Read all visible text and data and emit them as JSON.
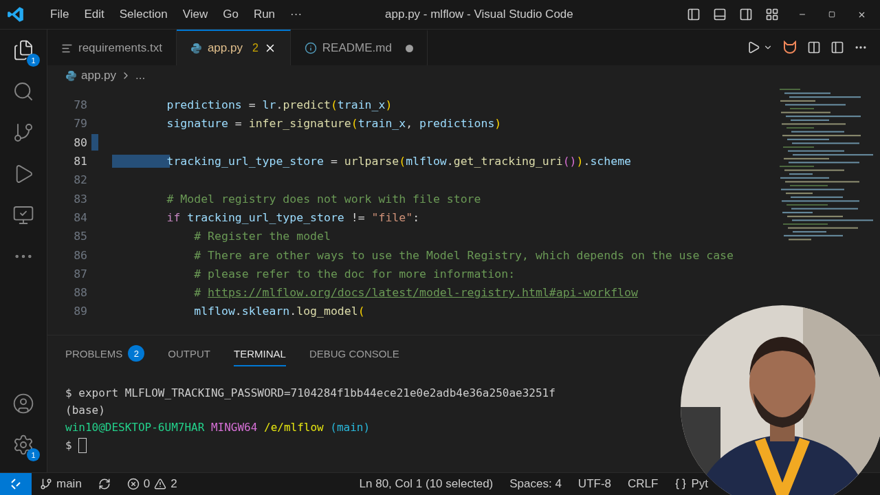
{
  "window": {
    "title": "app.py - mlflow - Visual Studio Code"
  },
  "menu": [
    "File",
    "Edit",
    "Selection",
    "View",
    "Go",
    "Run",
    "···"
  ],
  "activity_bar": {
    "explorer_badge": "1",
    "settings_badge": "1"
  },
  "tabs": [
    {
      "label": "requirements.txt",
      "kind": "text",
      "selected": false,
      "modified": false
    },
    {
      "label": "app.py",
      "kind": "python",
      "selected": true,
      "problems": "2",
      "modified": false
    },
    {
      "label": "README.md",
      "kind": "info",
      "selected": false,
      "modified": true
    }
  ],
  "breadcrumb": [
    "app.py",
    "..."
  ],
  "editor": {
    "lines": [
      {
        "number": "78",
        "selected": false,
        "tokens": [
          {
            "text": "        predictions",
            "kind": "var"
          },
          {
            "text": " = ",
            "kind": "op"
          },
          {
            "text": "lr",
            "kind": "var"
          },
          {
            "text": ".",
            "kind": "op"
          },
          {
            "text": "predict",
            "kind": "func"
          },
          {
            "text": "(",
            "kind": "paren"
          },
          {
            "text": "train_x",
            "kind": "var"
          },
          {
            "text": ")",
            "kind": "paren"
          }
        ]
      },
      {
        "number": "79",
        "selected": false,
        "tokens": [
          {
            "text": "        signature",
            "kind": "var"
          },
          {
            "text": " = ",
            "kind": "op"
          },
          {
            "text": "infer_signature",
            "kind": "func"
          },
          {
            "text": "(",
            "kind": "paren"
          },
          {
            "text": "train_x",
            "kind": "var"
          },
          {
            "text": ", ",
            "kind": "op"
          },
          {
            "text": "predictions",
            "kind": "var"
          },
          {
            "text": ")",
            "kind": "paren"
          }
        ]
      },
      {
        "number": "80",
        "selected": true
      },
      {
        "number": "81",
        "selected": true,
        "tokens": [
          {
            "text": "        tracking_url_type_store",
            "kind": "var"
          },
          {
            "text": " = ",
            "kind": "op"
          },
          {
            "text": "urlparse",
            "kind": "func"
          },
          {
            "text": "(",
            "kind": "paren"
          },
          {
            "text": "mlflow",
            "kind": "var"
          },
          {
            "text": ".",
            "kind": "op"
          },
          {
            "text": "get_tracking_uri",
            "kind": "func"
          },
          {
            "text": "()",
            "kind": "paren2"
          },
          {
            "text": ")",
            "kind": "paren"
          },
          {
            "text": ".",
            "kind": "op"
          },
          {
            "text": "scheme",
            "kind": "var"
          }
        ]
      },
      {
        "number": "82",
        "selected": false
      },
      {
        "number": "83",
        "selected": false,
        "tokens": [
          {
            "text": "        # Model registry does not work with file store",
            "kind": "comment"
          }
        ]
      },
      {
        "number": "84",
        "selected": false,
        "tokens": [
          {
            "text": "        if",
            "kind": "keyword"
          },
          {
            "text": " tracking_url_type_store",
            "kind": "var"
          },
          {
            "text": " != ",
            "kind": "op"
          },
          {
            "text": "\"file\"",
            "kind": "string"
          },
          {
            "text": ":",
            "kind": "op"
          }
        ]
      },
      {
        "number": "85",
        "selected": false,
        "tokens": [
          {
            "text": "            # Register the model",
            "kind": "comment"
          }
        ]
      },
      {
        "number": "86",
        "selected": false,
        "tokens": [
          {
            "text": "            # There are other ways to use the Model Registry, which depends on the use case",
            "kind": "comment"
          }
        ]
      },
      {
        "number": "87",
        "selected": false,
        "tokens": [
          {
            "text": "            # please refer to the doc for more information:",
            "kind": "comment"
          }
        ]
      },
      {
        "number": "88",
        "selected": false,
        "tokens": [
          {
            "text": "            # ",
            "kind": "comment"
          },
          {
            "text": "https://mlflow.org/docs/latest/model-registry.html#api-workflow",
            "kind": "link"
          }
        ]
      },
      {
        "number": "89",
        "selected": false,
        "tokens": [
          {
            "text": "            mlflow",
            "kind": "var"
          },
          {
            "text": ".",
            "kind": "op"
          },
          {
            "text": "sklearn",
            "kind": "var"
          },
          {
            "text": ".",
            "kind": "op"
          },
          {
            "text": "log_model",
            "kind": "func"
          },
          {
            "text": "(",
            "kind": "paren"
          }
        ]
      }
    ]
  },
  "panel": {
    "tabs": [
      {
        "label": "PROBLEMS",
        "badge": "2",
        "selected": false
      },
      {
        "label": "OUTPUT",
        "selected": false
      },
      {
        "label": "TERMINAL",
        "selected": true
      },
      {
        "label": "DEBUG CONSOLE",
        "selected": false
      }
    ],
    "terminal": [
      [
        {
          "text": "$ export MLFLOW_TRACKING_PASSWORD=7104284f1bb44ece21e0e2adb4e36a250ae3251f",
          "kind": "plain"
        }
      ],
      [
        {
          "text": "(base)",
          "kind": "plain"
        }
      ],
      [
        {
          "text": "win10@DESKTOP-6UM7HAR",
          "kind": "user"
        },
        {
          "text": " MINGW64",
          "kind": "host"
        },
        {
          "text": " /e/mlflow",
          "kind": "path"
        },
        {
          "text": " (main)",
          "kind": "branch"
        }
      ],
      [
        {
          "text": "$ ",
          "kind": "plain"
        },
        {
          "kind": "cursor"
        }
      ]
    ]
  },
  "status_bar": {
    "branch": "main",
    "errors": "0",
    "warnings": "2",
    "position": "Ln 80, Col 1 (10 selected)",
    "spaces": "Spaces: 4",
    "encoding": "UTF-8",
    "eol": "CRLF",
    "language": "Pyt"
  },
  "webcam": {
    "kind": "picture"
  }
}
